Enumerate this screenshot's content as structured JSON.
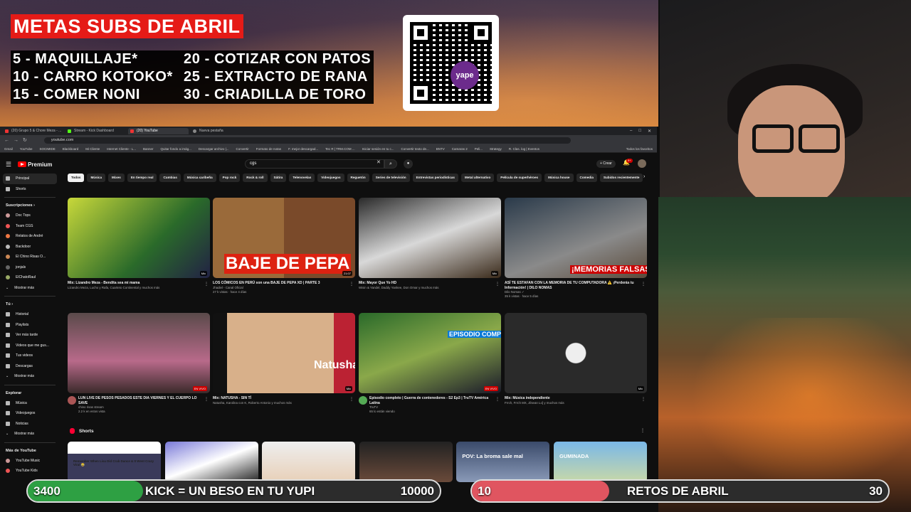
{
  "overlay": {
    "title": "METAS SUBS DE ABRIL",
    "goals": [
      "5 -   MAQUILLAJE*",
      "10 - CARRO KOTOKO*",
      "15 - COMER NONI",
      "20 - COTIZAR CON PATOS",
      "25 - EXTRACTO DE RANA",
      "30 - CRIADILLA DE TORO"
    ],
    "qr_label": "yape"
  },
  "browser": {
    "tabs": [
      "(20) Grupo 5 & Chore Meza - ...",
      "Stream - Kick Dashboard",
      "(20) YouTube",
      "Nueva pestaña"
    ],
    "url": "youtube.com",
    "bookmarks": [
      "Gmail",
      "YouTube",
      "SOCIMIDE",
      "Blackboard",
      "Mi Cliente",
      "Internet Cliente - L...",
      "Banner",
      "Quitar fondo a imág...",
      "Descargar archivo |...",
      "Convertir",
      "Formato de notas",
      "F. mejor descargad...",
      "Tec R | TRM.COM ...",
      "Iniciar sesión en tu c...",
      "Convertir texto de...",
      "BNTV",
      "Camaras 2",
      "Peli...",
      "Strategy",
      "R. Clas. log | Eventos"
    ],
    "bookmarks_right": "Todos los favoritos"
  },
  "youtube": {
    "logo": "Premium",
    "search_value": "cgs",
    "create_label": "+ Crear",
    "bell_count": "9+",
    "sidebar": {
      "main": [
        "Principal",
        "Shorts"
      ],
      "subs_header": "Suscripciones  ›",
      "subs": [
        "Doc Tops",
        "Team CGS",
        "Relatos de André",
        "Backdoor",
        "El Chino Risas O...",
        "jonjals",
        "ElChatoRaul"
      ],
      "subs_more": "Mostrar más",
      "you_header": "Tú  ›",
      "you": [
        "Historial",
        "Playlists",
        "Ver más tarde",
        "Videos que me gus...",
        "Tus videos",
        "Descargas"
      ],
      "you_more": "Mostrar más",
      "explore_header": "Explorar",
      "explore": [
        "Música",
        "Videojuegos",
        "Noticias"
      ],
      "explore_more": "Mostrar más",
      "more_header": "Más de YouTube",
      "more": [
        "YouTube Music",
        "YouTube Kids"
      ]
    },
    "chips": [
      "Todos",
      "Música",
      "Mixes",
      "En tiempo real",
      "Cumbias",
      "Música caribeña",
      "Pop rock",
      "Rock & roll",
      "Sátira",
      "Telenovelas",
      "Videojuegos",
      "Reguetón",
      "Series de televisión",
      "Entrevistas periodísticas",
      "Metal alternativo",
      "Película de superhéroes",
      "Música house",
      "Comedia",
      "Subidos recientemente"
    ],
    "videos": [
      {
        "title": "Mix: Lizandro Meza - Bendita sea mi mama",
        "sub1": "Lizandro Meza, Lucho y Rafa, Cuarteto Continental y muchos más",
        "sub2": "",
        "badge": "Mix",
        "thumb_text": ""
      },
      {
        "title": "LOS CÓMICOS EN PERÚ son una BAJE DE PEPA XD | PARTE 3",
        "sub1": "Jhadiel - Canal Oficial",
        "sub2": "27 k vistas · hace 4 días",
        "badge": "21:07",
        "thumb_text": "BAJE DE PEPA"
      },
      {
        "title": "Mix: Mayor Que Yo HD",
        "sub1": "Wisin & Yandel, Daddy Yankee, Don Omar y muchos más",
        "sub2": "",
        "badge": "Mix",
        "thumb_text": ""
      },
      {
        "title": "ASÍ TE ESTAFAN CON LA MEMORIA DE TU COMPUTADORA ⚠️ ¡Perderás tu Información! | DILO NOMAS",
        "sub1": "Dilo Nomas ✓",
        "sub2": "35 k vistas · hace 5 días",
        "badge": "",
        "thumb_text": "¡MEMORIAS FALSAS! AL DESCUBIERTO"
      },
      {
        "title": "LUN LIVE DE PESOS PESADOS ESTE DIA VIERNES Y EL CUERPO LO SAVE",
        "sub1": "chino risas stream",
        "sub2": "2.2 k en estos vista",
        "badge": "EN VIVO",
        "thumb_text": ""
      },
      {
        "title": "Mix: NATUSHA - SIN TÍ",
        "sub1": "Natusha, Karolina con K, Roberto Antonio y muchos más",
        "sub2": "",
        "badge": "Mix",
        "thumb_text": "Natusha"
      },
      {
        "title": "Episodio completo | Guerra de contenedores - S2 Ep3 | TruTV América Latina",
        "sub1": "TruTV",
        "sub2": "65 lo están viendo",
        "badge": "EN VIVO",
        "thumb_text": "EPISODIO COMPLETO"
      },
      {
        "title": "Mix: Música independiente",
        "sub1": "Frrch, Frrch MX, Jilsean Lo] y muchos más",
        "sub2": "",
        "badge": "Mix",
        "thumb_text": ""
      }
    ],
    "shorts_header": "Shorts",
    "shorts": [
      {
        "text": "Remember When Lisa Did Crab Dance & It Went Crazy Viral 😂"
      },
      {
        "text": ""
      },
      {
        "text": ""
      },
      {
        "text": ""
      },
      {
        "text": "POV: La broma sale mal"
      },
      {
        "text": "GUMINADA"
      }
    ]
  },
  "bars": {
    "left": {
      "min": "3400",
      "label": "KICK = UN BESO EN TU YUPI",
      "max": "10000",
      "progress": 0.28,
      "color": "#2ea043"
    },
    "right": {
      "min": "10",
      "label": "RETOS DE ABRIL",
      "max": "30",
      "progress": 0.33,
      "color": "#e05560"
    }
  }
}
